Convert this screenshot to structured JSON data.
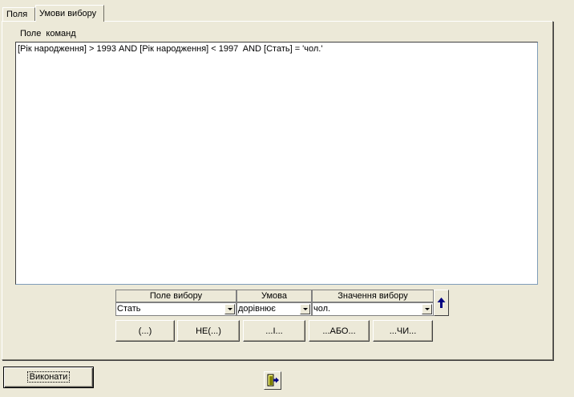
{
  "tabs": [
    {
      "label": "Поля",
      "active": false
    },
    {
      "label": "Умови вибору",
      "active": true
    }
  ],
  "command_field": {
    "label": "Поле  команд",
    "value": "[Рік народження] > 1993 AND [Рік народження] < 1997  AND [Стать] = 'чол.'"
  },
  "grid": {
    "headers": {
      "field": "Поле вибору",
      "condition": "Умова",
      "value": "Значення вибору"
    },
    "row": {
      "field": "Стать",
      "condition": "дорівнює",
      "value": "чол."
    }
  },
  "logic_buttons": {
    "group": "(...)",
    "not": "НЕ(...)",
    "and": "...І...",
    "or": "...АБО...",
    "or2": "...ЧИ..."
  },
  "execute_label": "Виконати",
  "icons": {
    "up_arrow": "arrow-up-icon",
    "exit": "exit-door-icon"
  },
  "colors": {
    "window_bg": "#ece9d8",
    "arrow": "#000080"
  }
}
